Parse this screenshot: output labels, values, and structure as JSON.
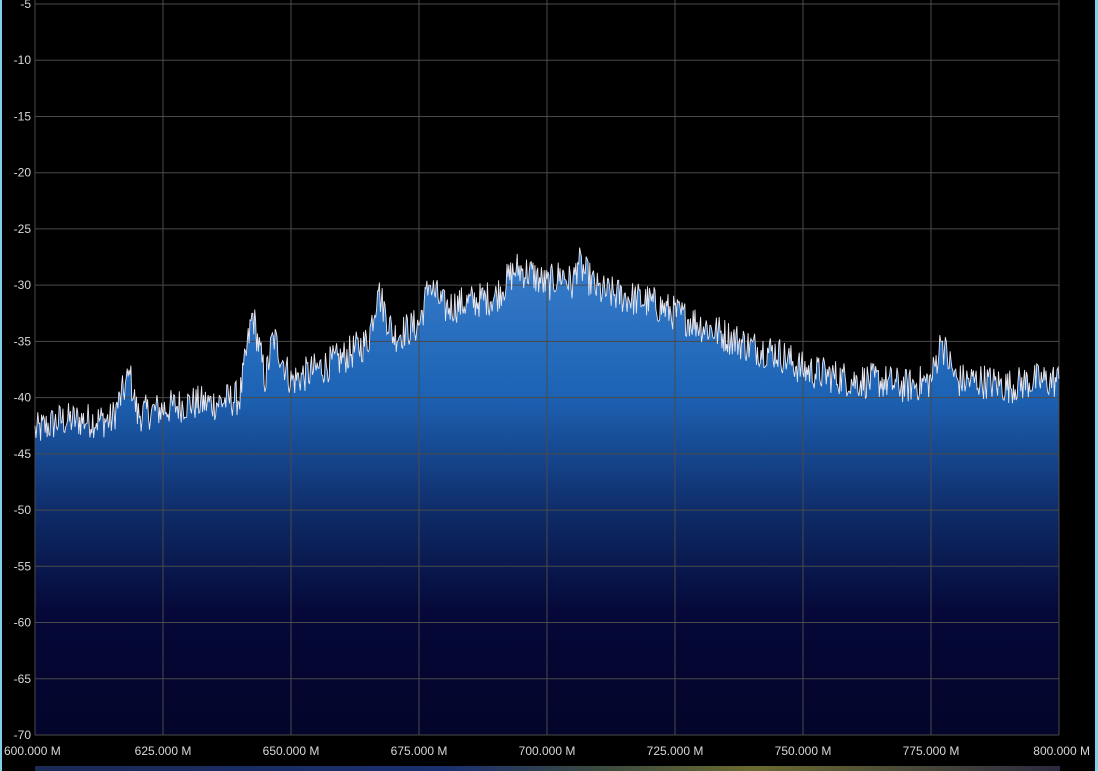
{
  "chart_data": {
    "type": "area",
    "title": "",
    "xlabel": "",
    "ylabel": "",
    "xlim": [
      600,
      800
    ],
    "ylim": [
      -70,
      -4
    ],
    "x_ticks": [
      600,
      625,
      650,
      675,
      700,
      725,
      750,
      775,
      800
    ],
    "x_tick_labels": [
      "600.000 M",
      "625.000 M",
      "650.000 M",
      "675.000 M",
      "700.000 M",
      "725.000 M",
      "750.000 M",
      "775.000 M",
      "800.000 M"
    ],
    "y_ticks": [
      -5,
      -10,
      -15,
      -20,
      -25,
      -30,
      -35,
      -40,
      -45,
      -50,
      -55,
      -60,
      -65,
      -70
    ],
    "y_tick_labels": [
      "-5",
      "-10",
      "-15",
      "-20",
      "-25",
      "-30",
      "-35",
      "-40",
      "-45",
      "-50",
      "-55",
      "-60",
      "-65",
      "-70"
    ],
    "grid": true,
    "series": [
      {
        "x": [
          600,
          605,
          610,
          615,
          618.5,
          620,
          625,
          630,
          635,
          640,
          642.5,
          645,
          646.5,
          650,
          655,
          660,
          665,
          667,
          670,
          675,
          677,
          680,
          685,
          690,
          694,
          697,
          700,
          703,
          705,
          706,
          710,
          715,
          720,
          725,
          730,
          735,
          740,
          745,
          750,
          755,
          760,
          765,
          770,
          775,
          777,
          780,
          785,
          790,
          795,
          800
        ],
        "values": [
          -43,
          -42,
          -42,
          -42,
          -38,
          -41.5,
          -41,
          -40.5,
          -40.5,
          -40,
          -32.5,
          -38.5,
          -34.5,
          -38.5,
          -37.5,
          -36.5,
          -35,
          -30.5,
          -34.5,
          -33.5,
          -30,
          -32,
          -31.5,
          -31,
          -28.5,
          -29,
          -30,
          -29,
          -30,
          -28,
          -30.5,
          -31,
          -31.5,
          -32.5,
          -33.5,
          -34.5,
          -35.5,
          -36,
          -37.5,
          -38,
          -38.5,
          -38.5,
          -39,
          -38.5,
          -35,
          -38.5,
          -38.5,
          -39,
          -38.5,
          -38.5
        ]
      }
    ],
    "colors": {
      "background": "#000000",
      "grid": "#4a4a4a",
      "trace": "#e6e6f0",
      "fill_top": "#2f76c8",
      "fill_bottom": "#03052a",
      "frame": "#7fd0e8"
    }
  }
}
